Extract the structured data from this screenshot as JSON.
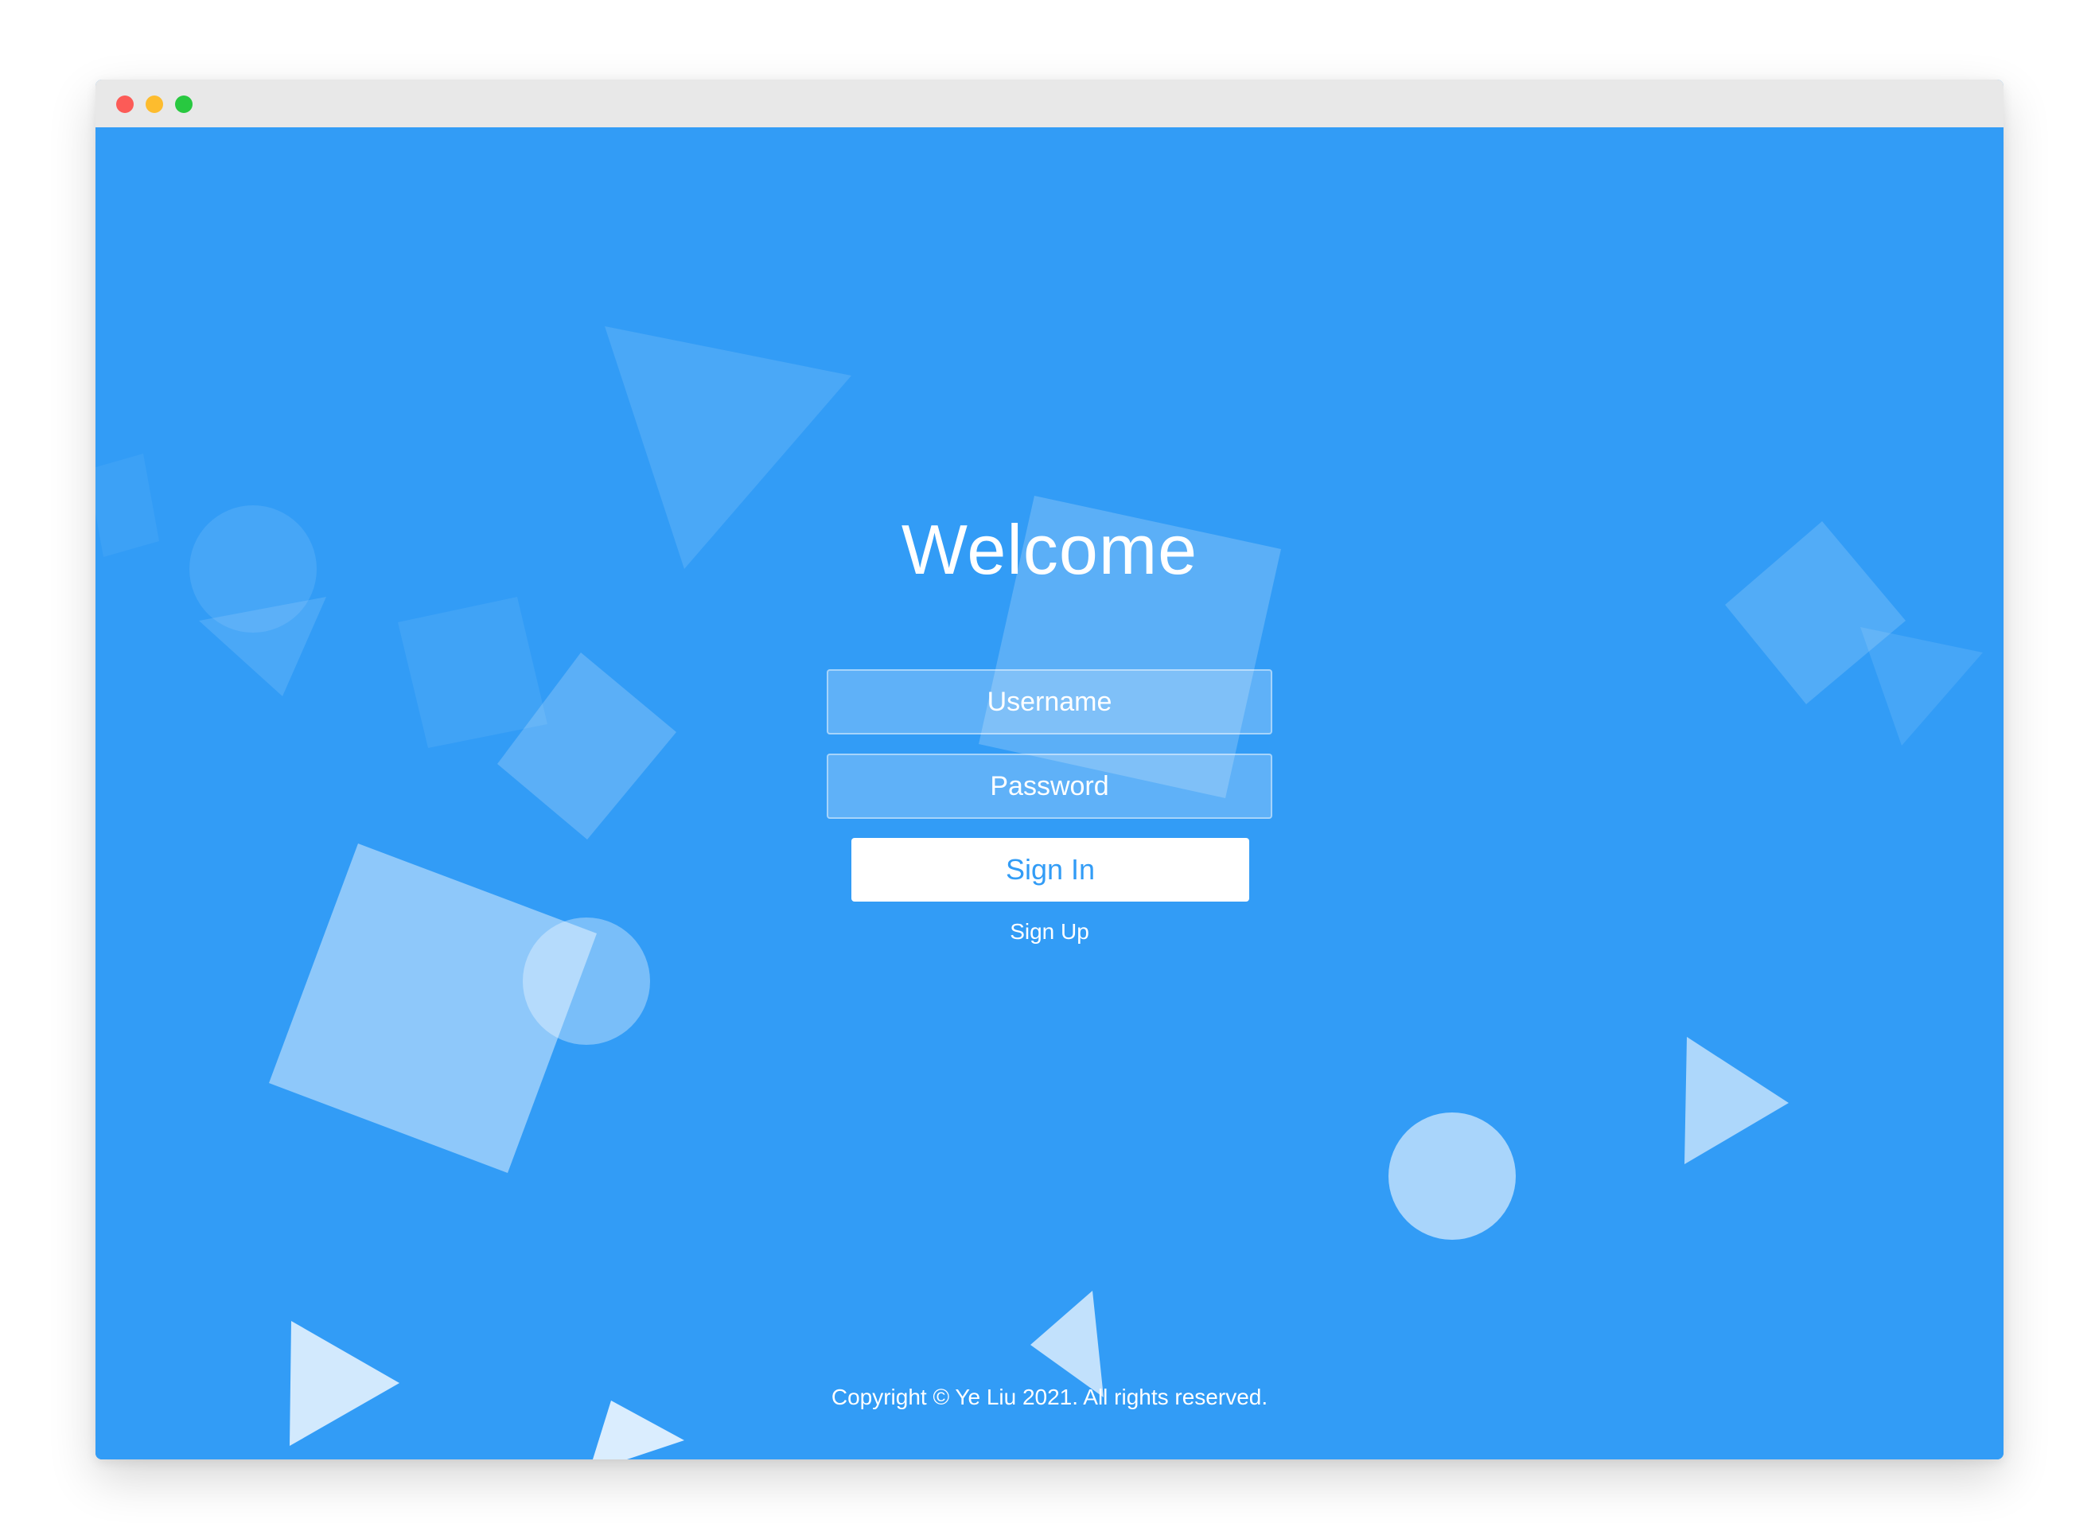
{
  "window": {
    "controls": {
      "close_color": "#fc5b57",
      "minimize_color": "#fdbc2e",
      "maximize_color": "#28c840"
    },
    "background_color": "#329cf6"
  },
  "login": {
    "title": "Welcome",
    "username_placeholder": "Username",
    "password_placeholder": "Password",
    "signin_label": "Sign In",
    "signup_label": "Sign Up"
  },
  "footer": {
    "copyright": "Copyright © Ye Liu 2021. All rights reserved."
  },
  "background_shapes": [
    "triangle",
    "square",
    "circle"
  ]
}
